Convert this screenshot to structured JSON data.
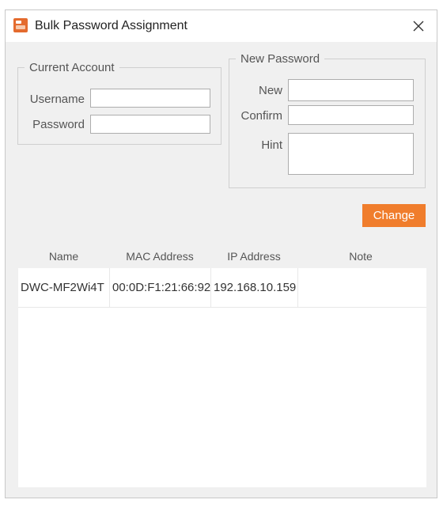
{
  "window": {
    "title": "Bulk Password Assignment",
    "icons": {
      "app": "app-logo-icon",
      "close": "close-icon"
    }
  },
  "current_account": {
    "legend": "Current Account",
    "username_label": "Username",
    "username_value": "",
    "password_label": "Password",
    "password_value": ""
  },
  "new_password": {
    "legend": "New Password",
    "new_label": "New",
    "new_value": "",
    "confirm_label": "Confirm",
    "confirm_value": "",
    "hint_label": "Hint",
    "hint_value": ""
  },
  "actions": {
    "change_label": "Change"
  },
  "device_table": {
    "columns": [
      "Name",
      "MAC Address",
      "IP Address",
      "Note"
    ],
    "rows": [
      {
        "name": "DWC-MF2Wi4T",
        "mac": "00:0D:F1:21:66:92",
        "ip": "192.168.10.159",
        "note": ""
      }
    ]
  },
  "colors": {
    "accent": "#f07d2c",
    "window_bg": "#f0f0f0",
    "titlebar_bg": "#ffffff"
  }
}
